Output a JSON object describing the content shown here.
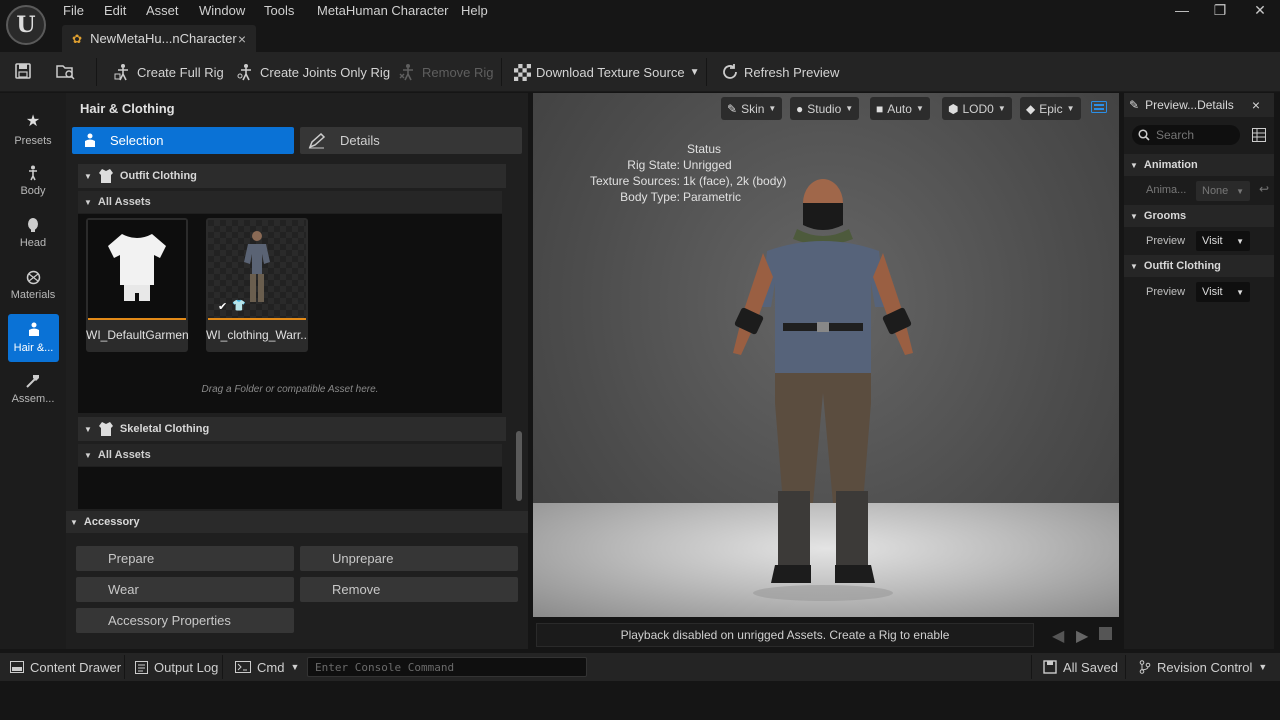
{
  "menu": [
    "File",
    "Edit",
    "Asset",
    "Window",
    "Tools",
    "MetaHuman Character",
    "Help"
  ],
  "document_tab": {
    "label": "NewMetaHu...nCharacter",
    "close": "×"
  },
  "window_controls": {
    "minimize": "—",
    "restore": "❐",
    "close": "✕"
  },
  "toolbar": {
    "create_full_rig": "Create Full Rig",
    "create_joints_only_rig": "Create Joints Only Rig",
    "remove_rig": "Remove Rig",
    "download_texture_source": "Download Texture Source",
    "refresh_preview": "Refresh Preview"
  },
  "left_strip": {
    "presets": "Presets",
    "body": "Body",
    "head": "Head",
    "materials": "Materials",
    "hair_clothing": "Hair &...",
    "assembly": "Assem..."
  },
  "hair_clothing_panel": {
    "title": "Hair & Clothing",
    "tab_selection": "Selection",
    "tab_details": "Details",
    "outfit_clothing": {
      "title": "Outfit Clothing",
      "subheader": "All Assets",
      "assets": [
        "WI_DefaultGarment",
        "WI_clothing_Warr..."
      ],
      "drop_hint": "Drag a Folder or compatible Asset here."
    },
    "skeletal_clothing": {
      "title": "Skeletal Clothing",
      "subheader": "All Assets"
    },
    "accessory": {
      "title": "Accessory",
      "prepare": "Prepare",
      "unprepare": "Unprepare",
      "wear": "Wear",
      "remove": "Remove",
      "properties": "Accessory Properties"
    }
  },
  "viewport": {
    "buttons": {
      "skin": "Skin",
      "studio": "Studio",
      "auto": "Auto",
      "lod": "LOD0",
      "quality": "Epic"
    },
    "status": {
      "heading": "Status",
      "rig_state_label": "Rig State:",
      "rig_state_value": "Unrigged",
      "texture_sources_label": "Texture Sources:",
      "texture_sources_value": "1k (face), 2k (body)",
      "body_type_label": "Body Type:",
      "body_type_value": "Parametric"
    },
    "playback_message": "Playback disabled on unrigged Assets. Create a Rig to enable"
  },
  "details_panel": {
    "tab": "Preview...Details",
    "tab_close": "×",
    "search_placeholder": "Search",
    "animation": {
      "title": "Animation",
      "row_label": "Anima...",
      "value": "None"
    },
    "grooms": {
      "title": "Grooms",
      "row_label": "Preview",
      "value": "Visit"
    },
    "outfit_clothing": {
      "title": "Outfit Clothing",
      "row_label": "Preview",
      "value": "Visit"
    }
  },
  "status_bar": {
    "content_drawer": "Content Drawer",
    "output_log": "Output Log",
    "cmd": "Cmd",
    "console_placeholder": "Enter Console Command",
    "all_saved": "All Saved",
    "revision_control": "Revision Control"
  },
  "colors": {
    "accent": "#0a72d6",
    "tile_underline": "#e28a18"
  }
}
